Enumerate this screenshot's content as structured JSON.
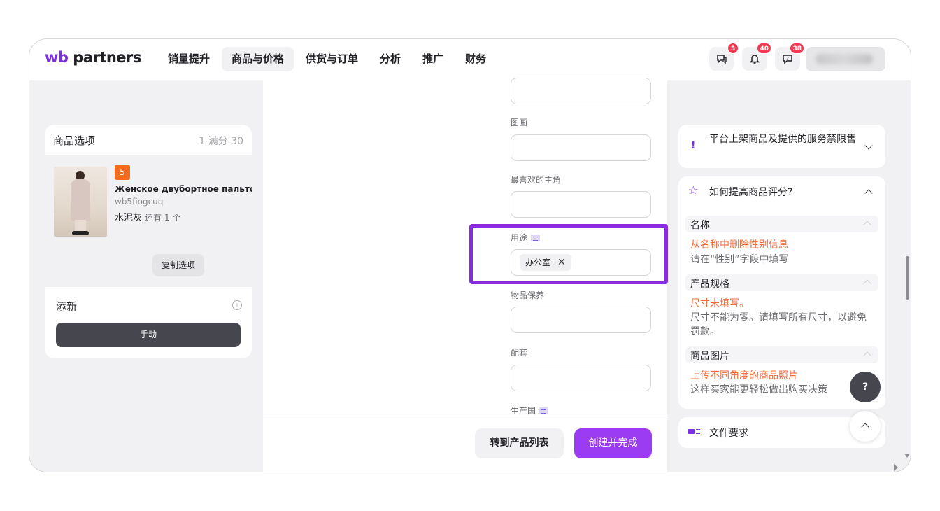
{
  "header": {
    "logo_wb": "wb",
    "logo_rest": " partners",
    "nav": [
      "销量提升",
      "商品与价格",
      "供货与订单",
      "分析",
      "推广",
      "财务"
    ],
    "active_nav": "商品与价格",
    "badges": {
      "chat": "5",
      "notifications": "40",
      "support": "38"
    },
    "accent": "#7b2fe0"
  },
  "left": {
    "title": "商品选项",
    "count": "1 满分 30",
    "variant": {
      "number": "5",
      "name": "Женское двубортное пальто...",
      "code": "wb5fiogcuq",
      "color": "水泥灰",
      "stock": "还有 1 个"
    },
    "copy_button": "复制选项",
    "add_label": "添新",
    "manual_button": "手动"
  },
  "form": {
    "fields": [
      {
        "label": "图画",
        "value": ""
      },
      {
        "label": "最喜欢的主角",
        "value": ""
      },
      {
        "label": "用途",
        "chip": "办公室"
      },
      {
        "label": "物品保养",
        "value": ""
      },
      {
        "label": "配套",
        "value": ""
      },
      {
        "label": "生产国",
        "value": ""
      }
    ],
    "btn_list": "转到产品列表",
    "btn_create": "创建并完成",
    "highlight_color": "#8a2be2"
  },
  "right": {
    "banner": "平台上架商品及提供的服务禁限售",
    "rating_title": "如何提高商品评分?",
    "sections": [
      {
        "title": "名称",
        "warning": "从名称中删除性别信息",
        "hint": "请在“性别”字段中填写"
      },
      {
        "title": "产品规格",
        "warning": "尺寸未填写。",
        "hint": "尺寸不能为零。请填写所有尺寸，以避免罚款。"
      },
      {
        "title": "商品图片",
        "warning": "上传不同角度的商品照片",
        "hint": "这样买家能更轻松做出购买决策"
      }
    ],
    "file_req": "文件要求",
    "help": "?"
  },
  "icons": [
    "chat-icon",
    "bell-icon",
    "support-icon",
    "info-icon",
    "close-icon",
    "star-icon",
    "chevron-down-icon",
    "chevron-up-icon",
    "document-icon"
  ]
}
